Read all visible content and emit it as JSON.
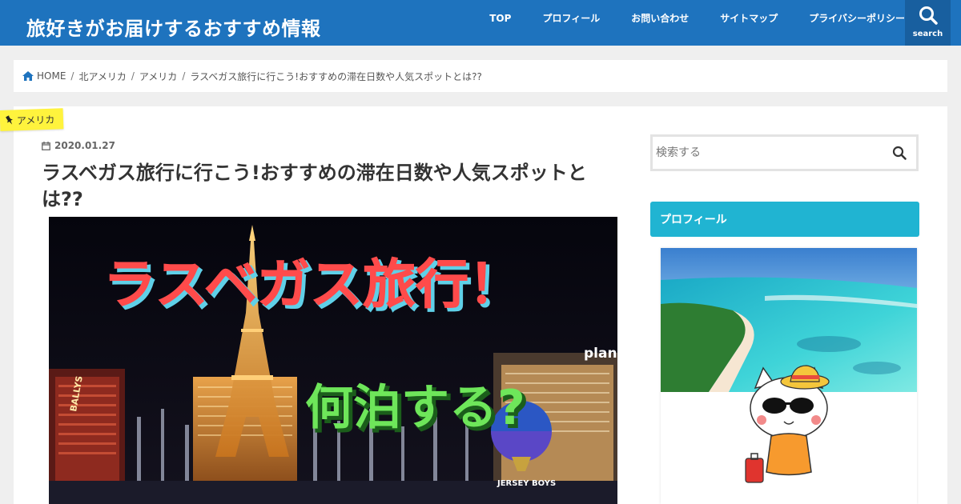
{
  "header": {
    "site_title": "旅好きがお届けするおすすめ情報",
    "nav": [
      "TOP",
      "プロフィール",
      "お問い合わせ",
      "サイトマップ",
      "プライバシーポリシー"
    ],
    "search_label": "search"
  },
  "breadcrumb": {
    "items": [
      "HOME",
      "北アメリカ",
      "アメリカ",
      "ラスベガス旅行に行こう!おすすめの滞在日数や人気スポットとは??"
    ],
    "separator": "/"
  },
  "post": {
    "category": "アメリカ",
    "date": "2020.01.27",
    "title": "ラスベガス旅行に行こう!おすすめの滞在日数や人気スポットとは??",
    "eyecatch": {
      "line1": "ラスベガス旅行！",
      "line2": "何泊する?",
      "sign_planet": "plan",
      "sign_ballys": "BALLYS",
      "sign_jersey": "JERSEY BOYS"
    }
  },
  "sidebar": {
    "search_placeholder": "検索する",
    "profile_heading": "プロフィール"
  },
  "colors": {
    "header_bg": "#1e73be",
    "accent_cyan": "#20b4d2",
    "category_yellow": "#fff33d",
    "eyecatch_text_red": "#ff4b4b",
    "eyecatch_text_green": "#6ee65a"
  }
}
